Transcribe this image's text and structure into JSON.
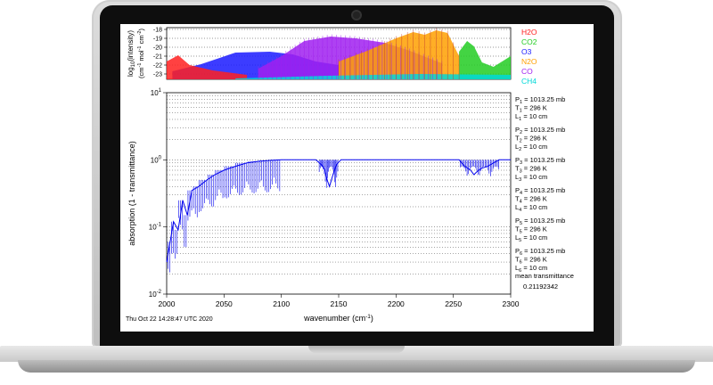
{
  "chart_data": [
    {
      "type": "area",
      "panel": "spectral line intensities",
      "ylabel": "log10(intensity) (cm-1 mol-1 cm-2)",
      "ylabel_parts": {
        "base": "log",
        "sub": "10",
        "rest": "(intensity)",
        "unit_a": "(cm",
        "unit_a_sup": "-1",
        "unit_b": " mol",
        "unit_b_sup": "-1",
        "unit_c": " cm",
        "unit_c_sup": "-2",
        "unit_close": ")"
      },
      "yticks": [
        "-18",
        "-19",
        "-20",
        "-21",
        "-22",
        "-23"
      ],
      "ylim": [
        -23.6,
        -17.8
      ],
      "xlim": [
        2000,
        2300
      ],
      "series": [
        {
          "name": "H2O",
          "color": "#ff2020",
          "band": [
            [
              2000,
              -21.6
            ],
            [
              2010,
              -20.9
            ],
            [
              2020,
              -22.0
            ],
            [
              2040,
              -22.6
            ],
            [
              2070,
              -23.1
            ]
          ]
        },
        {
          "name": "CO2",
          "color": "#22cc22",
          "band": [
            [
              2255,
              -20.5
            ],
            [
              2262,
              -19.3
            ],
            [
              2268,
              -19.9
            ],
            [
              2275,
              -21.7
            ],
            [
              2285,
              -22.2
            ],
            [
              2300,
              -21.0
            ]
          ]
        },
        {
          "name": "O3",
          "color": "#1a1aff",
          "band": [
            [
              2005,
              -22.7
            ],
            [
              2030,
              -21.9
            ],
            [
              2060,
              -20.6
            ],
            [
              2090,
              -20.5
            ],
            [
              2110,
              -20.8
            ],
            [
              2130,
              -21.6
            ],
            [
              2150,
              -22.0
            ]
          ]
        },
        {
          "name": "N2O",
          "color": "#ffa000",
          "band": [
            [
              2150,
              -21.6
            ],
            [
              2175,
              -20.4
            ],
            [
              2200,
              -19.0
            ],
            [
              2215,
              -18.3
            ],
            [
              2225,
              -18.6
            ],
            [
              2235,
              -18.1
            ],
            [
              2245,
              -18.4
            ],
            [
              2255,
              -21.0
            ]
          ]
        },
        {
          "name": "CO",
          "color": "#a020f0",
          "band": [
            [
              2080,
              -22.4
            ],
            [
              2100,
              -21.0
            ],
            [
              2120,
              -19.3
            ],
            [
              2143,
              -18.8
            ],
            [
              2165,
              -19.0
            ],
            [
              2190,
              -19.5
            ],
            [
              2210,
              -20.3
            ],
            [
              2240,
              -21.8
            ]
          ]
        },
        {
          "name": "CH4",
          "color": "#00d8d8",
          "band": [
            [
              2060,
              -23.5
            ],
            [
              2140,
              -23.2
            ],
            [
              2220,
              -23.0
            ],
            [
              2300,
              -23.1
            ]
          ]
        }
      ]
    },
    {
      "type": "line",
      "panel": "absorption",
      "xlabel": "wavenumber (cm-1)",
      "xlabel_parts": {
        "text": "wavenumber (cm",
        "sup": "-1",
        "close": ")"
      },
      "ylabel": "absorption (1 - transmittance)",
      "yscale": "log",
      "ylim": [
        0.01,
        10
      ],
      "yticks": [
        {
          "base": "10",
          "exp": "1",
          "value": 10
        },
        {
          "base": "10",
          "exp": "0",
          "value": 1
        },
        {
          "base": "10",
          "exp": "-1",
          "value": 0.1
        },
        {
          "base": "10",
          "exp": "-2",
          "value": 0.01
        }
      ],
      "xlim": [
        2000,
        2300
      ],
      "xticks": [
        2000,
        2050,
        2100,
        2150,
        2200,
        2250,
        2300
      ],
      "series": [
        {
          "name": "absorption",
          "color": "#0000ee",
          "x": [
            2000,
            2003,
            2006,
            2010,
            2014,
            2018,
            2022,
            2028,
            2035,
            2042,
            2050,
            2060,
            2070,
            2080,
            2090,
            2100,
            2110,
            2120,
            2130,
            2135,
            2138,
            2140,
            2142,
            2145,
            2148,
            2152,
            2160,
            2180,
            2200,
            2220,
            2240,
            2255,
            2260,
            2265,
            2268,
            2270,
            2272,
            2275,
            2280,
            2285,
            2290,
            2300
          ],
          "y": [
            0.03,
            0.06,
            0.12,
            0.09,
            0.25,
            0.15,
            0.35,
            0.4,
            0.5,
            0.6,
            0.7,
            0.8,
            0.9,
            0.95,
            0.98,
            1.0,
            1.0,
            1.0,
            1.0,
            0.85,
            0.7,
            0.5,
            0.4,
            0.6,
            0.85,
            1.0,
            1.0,
            1.0,
            1.0,
            1.0,
            1.0,
            1.0,
            0.8,
            0.7,
            0.6,
            0.65,
            0.7,
            0.75,
            0.8,
            0.9,
            1.0,
            1.0
          ]
        }
      ]
    }
  ],
  "conditions": [
    {
      "P": "P",
      "Pi": "1",
      "Pv": " = 1013.25 mb",
      "T": "T",
      "Ti": "1",
      "Tv": " = 296 K",
      "L": "L",
      "Li": "1",
      "Lv": " = 10 cm"
    },
    {
      "P": "P",
      "Pi": "2",
      "Pv": " = 1013.25 mb",
      "T": "T",
      "Ti": "2",
      "Tv": " = 296 K",
      "L": "L",
      "Li": "2",
      "Lv": " = 10 cm"
    },
    {
      "P": "P",
      "Pi": "3",
      "Pv": " = 1013.25 mb",
      "T": "T",
      "Ti": "3",
      "Tv": " = 296 K",
      "L": "L",
      "Li": "3",
      "Lv": " = 10 cm"
    },
    {
      "P": "P",
      "Pi": "4",
      "Pv": " = 1013.25 mb",
      "T": "T",
      "Ti": "4",
      "Tv": " = 296 K",
      "L": "L",
      "Li": "4",
      "Lv": " = 10 cm"
    },
    {
      "P": "P",
      "Pi": "5",
      "Pv": " = 1013.25 mb",
      "T": "T",
      "Ti": "5",
      "Tv": " = 296 K",
      "L": "L",
      "Li": "5",
      "Lv": " = 10 cm"
    },
    {
      "P": "P",
      "Pi": "6",
      "Pv": " = 1013.25 mb",
      "T": "T",
      "Ti": "6",
      "Tv": " = 296 K",
      "L": "L",
      "Li": "6",
      "Lv": " = 10 cm"
    }
  ],
  "mean_transmittance_label": "mean transmittance",
  "mean_transmittance_value": "0.21192342",
  "timestamp": "Thu Oct 22 14:28:47 UTC 2020"
}
